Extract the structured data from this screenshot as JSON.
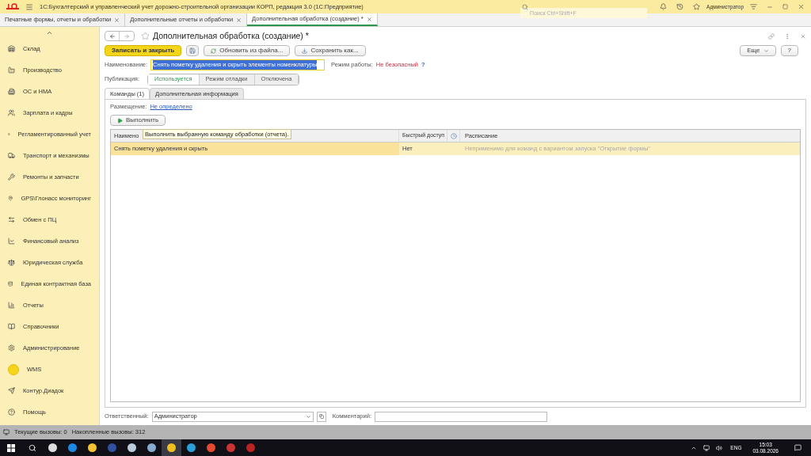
{
  "app": {
    "title": "1С:Бухгалтерский и управленческий учет дорожно-строительной организации КОРП, редакция 3.0  (1С:Предприятие)",
    "search": {
      "placeholder": "Поиск Ctrl+Shift+F"
    },
    "user": "Администратор"
  },
  "open_tabs": [
    {
      "label": "Печатные формы, отчеты и обработки",
      "selected": false
    },
    {
      "label": "Дополнительные отчеты и обработки",
      "selected": false
    },
    {
      "label": "Дополнительная обработка (создание) *",
      "selected": true
    }
  ],
  "sidebar": {
    "items": [
      {
        "label": "Склад"
      },
      {
        "label": "Производство"
      },
      {
        "label": "ОС и НМА"
      },
      {
        "label": "Зарплата и кадры"
      },
      {
        "label": "Регламентированный учет"
      },
      {
        "label": "Транспорт и механизмы"
      },
      {
        "label": "Ремонты и запчасти"
      },
      {
        "label": "GPS\\Глонасс мониторинг"
      },
      {
        "label": "Обмен с ПЦ"
      },
      {
        "label": "Финансовый анализ"
      },
      {
        "label": "Юридическая служба"
      },
      {
        "label": "Единая контрактная база"
      },
      {
        "label": "Отчеты"
      },
      {
        "label": "Справочники"
      },
      {
        "label": "Администрирование"
      },
      {
        "label": "WMS"
      },
      {
        "label": "Контур.Диадок"
      },
      {
        "label": "Помощь"
      }
    ]
  },
  "form": {
    "title": "Дополнительная обработка (создание) *",
    "toolbar": {
      "save_close": "Записать и закрыть",
      "refresh": "Обновить из файла...",
      "save_as": "Сохранить как...",
      "more": "Еще",
      "help": "?"
    },
    "name": {
      "label": "Наименование:",
      "value": "Снять пометку удаления и скрыть элементы номенклатуры"
    },
    "mode": {
      "label": "Режим работы:",
      "value": "Не безопасный",
      "help": "?"
    },
    "publication": {
      "label": "Публикация:",
      "options": [
        {
          "label": "Используется",
          "selected": true
        },
        {
          "label": "Режим отладки",
          "selected": false
        },
        {
          "label": "Отключена",
          "selected": false
        }
      ]
    },
    "tabs": [
      {
        "label": "Команды (1)",
        "selected": true
      },
      {
        "label": "Дополнительная информация",
        "selected": false
      }
    ],
    "placement": {
      "label": "Размещение:",
      "link": "Не определено"
    },
    "run_button": "Выполнить",
    "tooltip": "Выполнить выбранную команду обработки (отчета).",
    "table": {
      "columns": [
        "Наимено",
        "Быстрый доступ",
        "Расписание"
      ],
      "rows": [
        {
          "name": "Снять пометку удаления и скрыть",
          "quick_access": "Нет",
          "schedule": "Неприменимо для команд с вариантом запуска \"Открытие формы\"",
          "selected": true
        }
      ]
    },
    "responsible": {
      "label": "Ответственный:",
      "value": "Администратор"
    },
    "comment": {
      "label": "Комментарий:"
    }
  },
  "status_bar": {
    "current": "Текущие вызовы: 0",
    "accumulated": "Накопленные вызовы: 312"
  },
  "taskbar": {
    "lang": "ENG",
    "time": "15:03",
    "date": "03.08.2026"
  }
}
